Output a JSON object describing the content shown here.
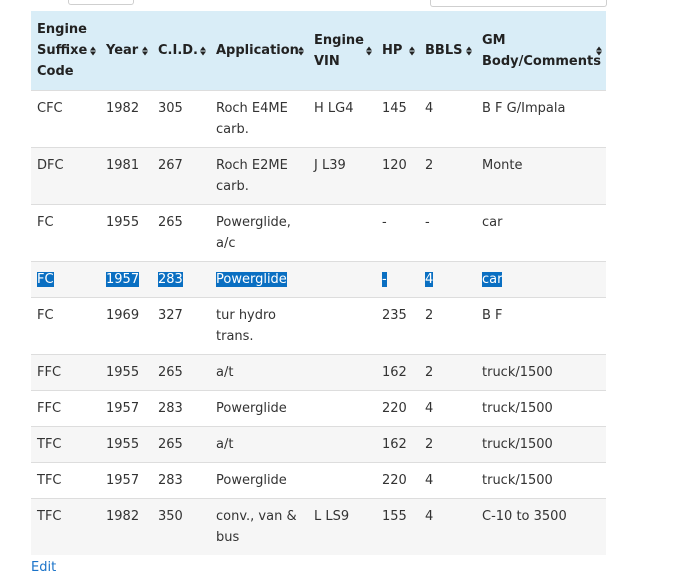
{
  "headers": [
    {
      "label": "Engine Suffixe Code"
    },
    {
      "label": "Year"
    },
    {
      "label": "C.I.D."
    },
    {
      "label": "Application"
    },
    {
      "label": "Engine VIN"
    },
    {
      "label": "HP"
    },
    {
      "label": "BBLS"
    },
    {
      "label": "GM Body/Comments"
    }
  ],
  "rows": [
    [
      "CFC",
      "1982",
      "305",
      "Roch E4ME carb.",
      "H LG4",
      "145",
      "4",
      "B F G/Impala"
    ],
    [
      "DFC",
      "1981",
      "267",
      "Roch E2ME carb.",
      "J L39",
      "120",
      "2",
      "Monte"
    ],
    [
      "FC",
      "1955",
      "265",
      "Powerglide, a/c",
      "",
      "-",
      "-",
      "car"
    ],
    [
      "FC",
      "1957",
      "283",
      "Powerglide",
      "",
      "-",
      "4",
      "car"
    ],
    [
      "FC",
      "1969",
      "327",
      "tur hydro trans.",
      "",
      "235",
      "2",
      "B F"
    ],
    [
      "FFC",
      "1955",
      "265",
      "a/t",
      "",
      "162",
      "2",
      "truck/1500"
    ],
    [
      "FFC",
      "1957",
      "283",
      "Powerglide",
      "",
      "220",
      "4",
      "truck/1500"
    ],
    [
      "TFC",
      "1955",
      "265",
      "a/t",
      "",
      "162",
      "2",
      "truck/1500"
    ],
    [
      "TFC",
      "1957",
      "283",
      "Powerglide",
      "",
      "220",
      "4",
      "truck/1500"
    ],
    [
      "TFC",
      "1982",
      "350",
      "conv., van & bus",
      "L LS9",
      "155",
      "4",
      "C-10 to 3500"
    ]
  ],
  "selected_row": 3,
  "edit_link": "Edit",
  "colors": {
    "header_bg": "#d9edf7",
    "selection": "#0a6fc2",
    "link": "#1a73c9"
  }
}
